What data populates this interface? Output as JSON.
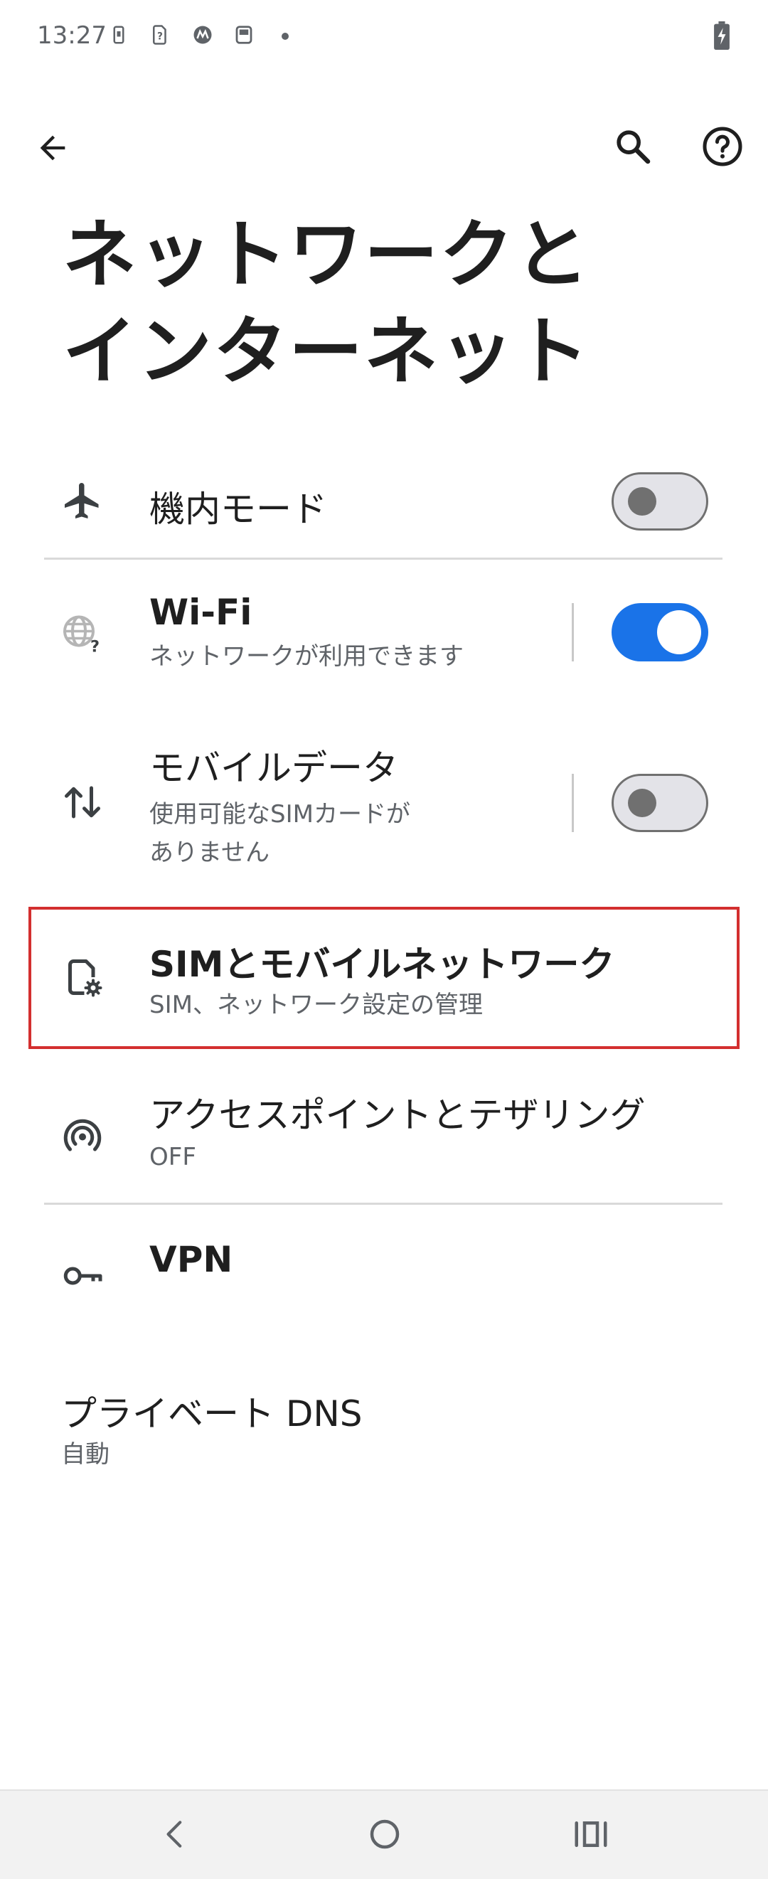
{
  "status_bar": {
    "time": "13:27"
  },
  "header": {
    "title_line1": "ネットワークと",
    "title_line2": "インターネット"
  },
  "colors": {
    "accent": "#1a73e8",
    "highlight": "#d32f2f"
  },
  "items": [
    {
      "title": "機内モード",
      "icon": "airplane-icon",
      "toggle": "off"
    },
    {
      "title": "Wi-Fi",
      "subtitle": "ネットワークが利用できます",
      "icon": "wifi-globe-icon",
      "toggle": "on"
    },
    {
      "title": "モバイルデータ",
      "subtitle_line1": "使用可能なSIMカードが",
      "subtitle_line2": "ありません",
      "icon": "data-arrows-icon",
      "toggle": "off"
    },
    {
      "title": "SIMとモバイルネットワーク",
      "subtitle": "SIM、ネットワーク設定の管理",
      "icon": "sim-settings-icon"
    },
    {
      "title": "アクセスポイントとテザリング",
      "subtitle": "OFF",
      "icon": "hotspot-icon"
    },
    {
      "title": "VPN",
      "icon": "key-icon"
    },
    {
      "title": "プライベート DNS",
      "subtitle": "自動"
    }
  ]
}
